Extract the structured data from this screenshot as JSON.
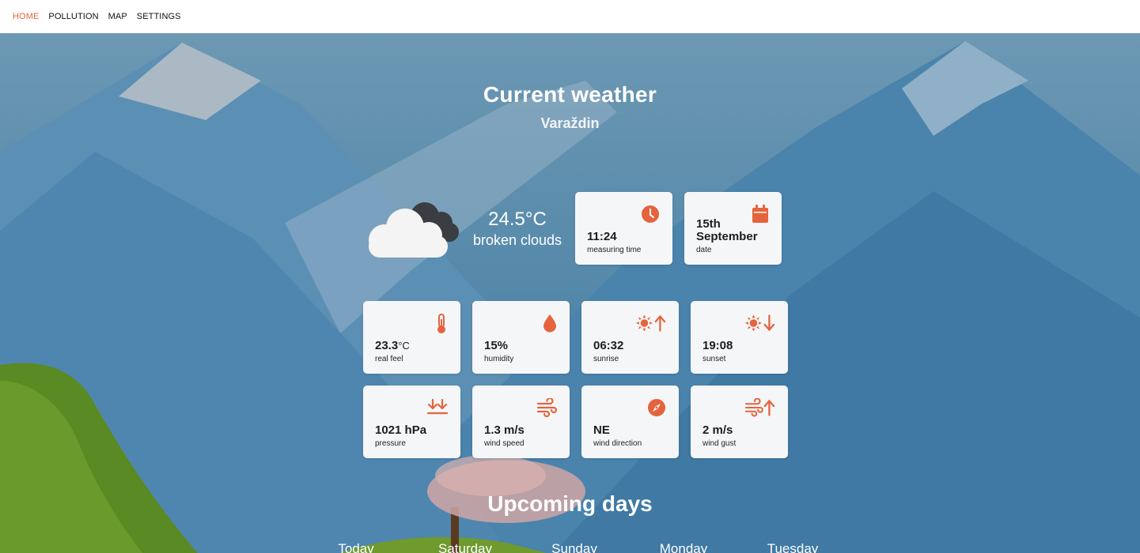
{
  "nav": {
    "items": [
      "HOME",
      "POLLUTION",
      "MAP",
      "SETTINGS"
    ]
  },
  "main": {
    "title": "Current weather",
    "city": "Varaždin",
    "temperature": "24.5°C",
    "description": "broken clouds",
    "weather_icon": "broken-clouds-icon"
  },
  "cards": {
    "time": {
      "value": "11:24",
      "label": "measuring time",
      "icon": "clock-icon"
    },
    "date": {
      "value": "15th September",
      "label": "date",
      "icon": "calendar-icon"
    },
    "real_feel": {
      "value": "23.3",
      "unit": "°C",
      "label": "real feel",
      "icon": "thermometer-icon"
    },
    "humidity": {
      "value": "15%",
      "label": "humidity",
      "icon": "water-drop-icon"
    },
    "sunrise": {
      "value": "06:32",
      "label": "sunrise",
      "icon": "sunrise-icon"
    },
    "sunset": {
      "value": "19:08",
      "label": "sunset",
      "icon": "sunset-icon"
    },
    "pressure": {
      "value": "1021 hPa",
      "label": "pressure",
      "icon": "pressure-icon"
    },
    "wind_speed": {
      "value": "1.3 m/s",
      "label": "wind speed",
      "icon": "wind-icon"
    },
    "wind_direction": {
      "value": "NE",
      "label": "wind direction",
      "icon": "compass-icon"
    },
    "wind_gust": {
      "value": "2 m/s",
      "label": "wind gust",
      "icon": "wind-gust-icon"
    }
  },
  "upcoming": {
    "title": "Upcoming days",
    "days": [
      "Today",
      "Saturday",
      "Sunday",
      "Monday",
      "Tuesday"
    ]
  },
  "colors": {
    "accent": "#e5643d",
    "card_bg": "#f5f6f8",
    "sky": "#3f7aa0"
  }
}
